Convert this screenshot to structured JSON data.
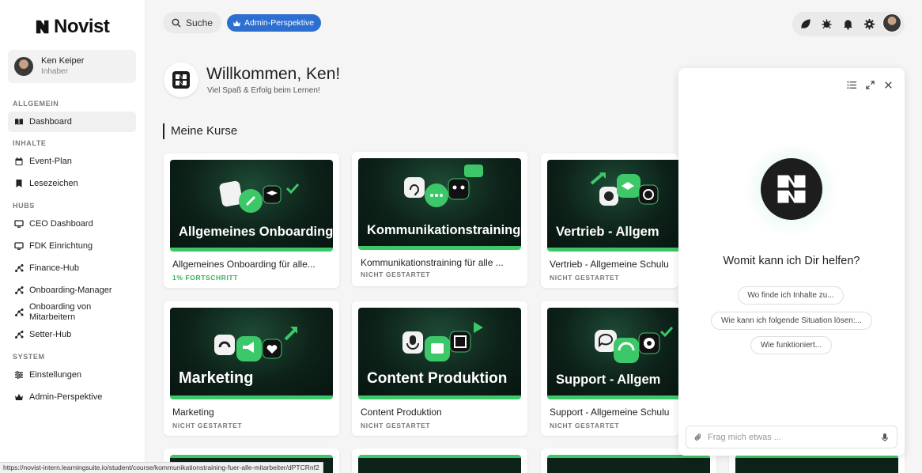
{
  "brand": {
    "name": "Novist"
  },
  "user": {
    "name": "Ken Keiper",
    "role": "Inhaber"
  },
  "sidebar": {
    "sections": [
      {
        "label": "ALLGEMEIN"
      },
      {
        "label": "INHALTE"
      },
      {
        "label": "HUBS"
      },
      {
        "label": "SYSTEM"
      }
    ],
    "items": [
      {
        "label": "Dashboard",
        "icon": "book-open-icon",
        "active": true
      },
      {
        "label": "Event-Plan",
        "icon": "calendar-icon"
      },
      {
        "label": "Lesezeichen",
        "icon": "bookmark-icon"
      },
      {
        "label": "CEO Dashboard",
        "icon": "monitor-icon"
      },
      {
        "label": "FDK Einrichtung",
        "icon": "monitor-icon"
      },
      {
        "label": "Finance-Hub",
        "icon": "network-icon"
      },
      {
        "label": "Onboarding-Manager",
        "icon": "network-icon"
      },
      {
        "label": "Onboarding von Mitarbeitern",
        "icon": "network-icon"
      },
      {
        "label": "Setter-Hub",
        "icon": "network-icon"
      },
      {
        "label": "Einstellungen",
        "icon": "sliders-icon"
      },
      {
        "label": "Admin-Perspektive",
        "icon": "crown-icon"
      }
    ]
  },
  "topbar": {
    "search_label": "Suche",
    "admin_label": "Admin-Perspektive",
    "icons": [
      "leaf-icon",
      "bug-icon",
      "bell-icon",
      "gear-icon"
    ]
  },
  "welcome": {
    "title": "Willkommen, Ken!",
    "subtitle": "Viel Spaß & Erfolg beim Lernen!"
  },
  "courses_section": {
    "title": "Meine Kurse"
  },
  "courses": [
    {
      "thumb_title": "Allgemeines Onboarding",
      "title": "Allgemeines Onboarding für alle...",
      "status": "1% FORTSCHRITT",
      "status_color": "#36b15a"
    },
    {
      "thumb_title": "Kommunikationstraining",
      "title": "Kommunikationstraining für alle ...",
      "status": "NICHT GESTARTET"
    },
    {
      "thumb_title": "Vertrieb - Allgem",
      "title": "Vertrieb - Allgemeine Schulu",
      "status": "NICHT GESTARTET"
    },
    {
      "thumb_title": "Marketing",
      "title": "Marketing",
      "status": "NICHT GESTARTET"
    },
    {
      "thumb_title": "Content Produktion",
      "title": "Content Produktion",
      "status": "NICHT GESTARTET"
    },
    {
      "thumb_title": "Support - Allgem",
      "title": "Support - Allgemeine Schulu",
      "status": "NICHT GESTARTET"
    }
  ],
  "chat": {
    "question": "Womit kann ich Dir helfen?",
    "suggestions": [
      "Wo finde ich Inhalte zu...",
      "Wie kann ich folgende Situation lösen:...",
      "Wie funktioniert..."
    ],
    "input_placeholder": "Frag mich etwas ..."
  },
  "status_bar": {
    "url": "https://novist-intern.learningsuite.io/student/course/kommunikationstraining-fuer-alle-mitarbeiter/dPTCRnf2"
  },
  "colors": {
    "accent": "#2d6fd1",
    "brand_green": "#3cc769",
    "progress_green": "#36b15a"
  }
}
